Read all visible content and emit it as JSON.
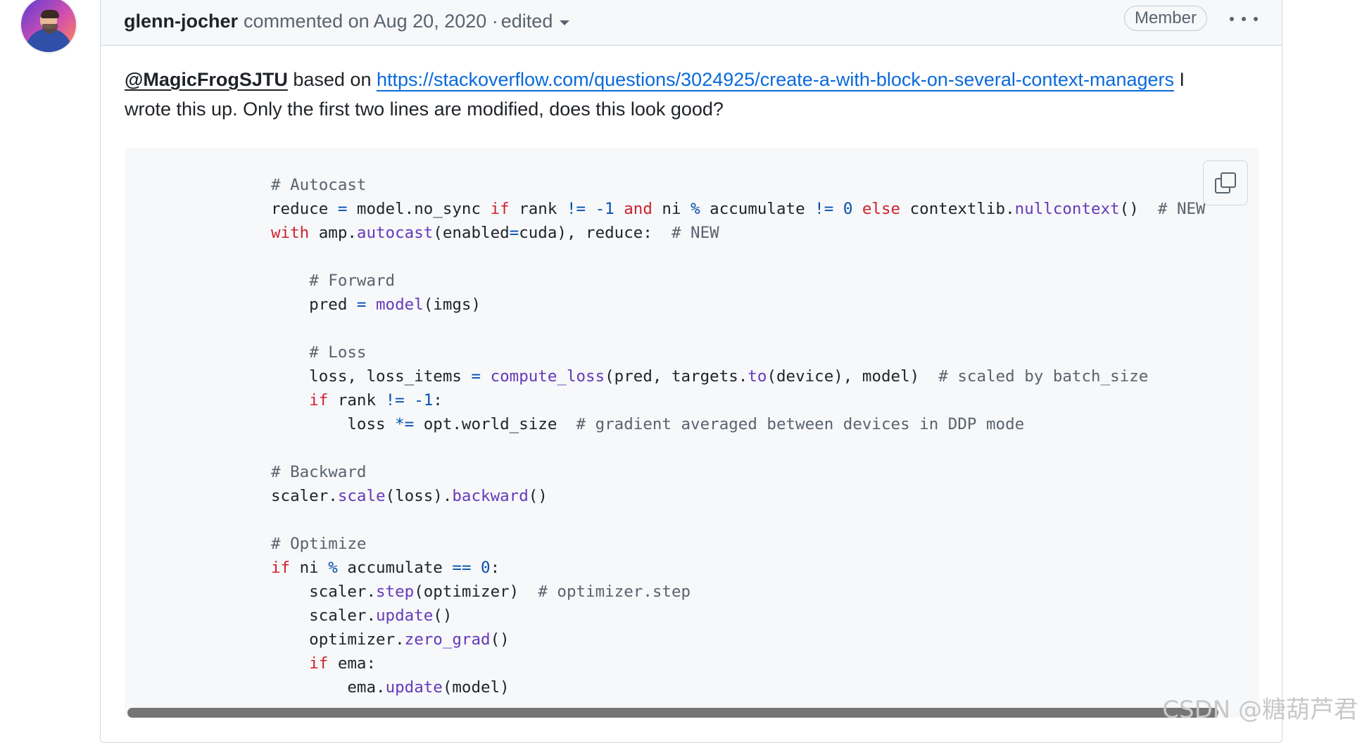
{
  "comment": {
    "author": "glenn-jocher",
    "meta": "commented on Aug 20, 2020 ·",
    "edited_label": "edited",
    "badge": "Member",
    "body": {
      "mention": "@MagicFrogSJTU",
      "text_before_link": " based on ",
      "link_text": "https://stackoverflow.com/questions/3024925/create-a-with-block-on-several-context-managers",
      "text_after_link": " I wrote this up. Only the first two lines are modified, does this look good?"
    }
  },
  "code_lines": [
    "# Autocast",
    "reduce = model.no_sync if rank != -1 and ni % accumulate != 0 else contextlib.nullcontext()  # NEW",
    "with amp.autocast(enabled=cuda), reduce:  # NEW",
    "",
    "    # Forward",
    "    pred = model(imgs)",
    "",
    "    # Loss",
    "    loss, loss_items = compute_loss(pred, targets.to(device), model)  # scaled by batch_size",
    "    if rank != -1:",
    "        loss *= opt.world_size  # gradient averaged between devices in DDP mode",
    "",
    "# Backward",
    "scaler.scale(loss).backward()",
    "",
    "# Optimize",
    "if ni % accumulate == 0:",
    "    scaler.step(optimizer)  # optimizer.step",
    "    scaler.update()",
    "    optimizer.zero_grad()",
    "    if ema:",
    "        ema.update(model)"
  ],
  "watermark": "CSDN @糖葫芦君",
  "colors": {
    "keyword": "#cf222e",
    "function": "#6639ba",
    "comment": "#59636e",
    "link": "#0969da"
  }
}
